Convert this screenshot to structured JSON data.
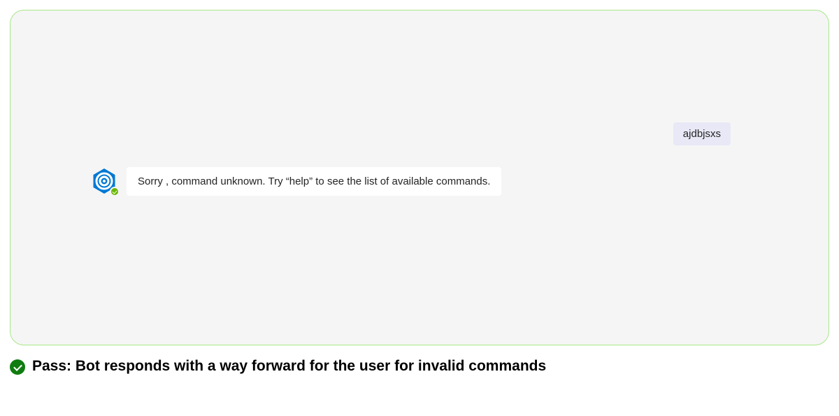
{
  "chat": {
    "user_message": "ajdbjsxs",
    "bot_message": "Sorry , command unknown. Try “help” to see the list of available commands."
  },
  "caption": {
    "text": "Pass: Bot responds with a way forward for the user for invalid commands"
  },
  "colors": {
    "panel_bg": "#f5f5f5",
    "panel_border": "#a8e888",
    "user_bubble": "#e8e8f7",
    "bot_bubble": "#ffffff",
    "avatar_primary": "#0078d4",
    "presence_available": "#6bb700",
    "pass_green": "#107c10"
  },
  "icons": {
    "bot_avatar": "hexagon-spiral-icon",
    "presence": "presence-available-icon",
    "pass": "check-circle-icon"
  }
}
